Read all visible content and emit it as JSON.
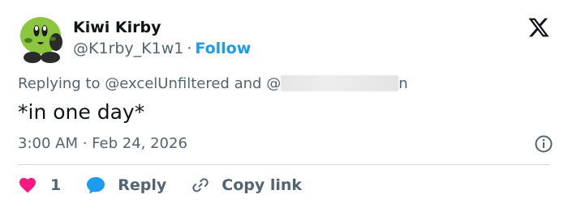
{
  "colors": {
    "accent": "#1d9bf0",
    "like": "#f91880",
    "reply": "#1d9bf0",
    "secondary_text": "#536471",
    "primary_text": "#0f1419",
    "divider": "#cfd9de"
  },
  "author": {
    "name": "Kiwi Kirby",
    "handle": "@K1rby_K1w1",
    "separator": "·",
    "follow_label": "Follow",
    "avatar_icon": "kirby-avatar"
  },
  "platform_icon": "x-logo-icon",
  "reply_context": {
    "prefix": "Replying to",
    "mention_1": "@excelUnfiltered",
    "conjunction": "and",
    "mention_2_start": "@",
    "mention_2_end": "n"
  },
  "tweet": {
    "text": "*in one day*",
    "timestamp": "3:00 AM · Feb 24, 2026"
  },
  "actions": {
    "like_count": "1",
    "reply_label": "Reply",
    "copy_link_label": "Copy link"
  }
}
